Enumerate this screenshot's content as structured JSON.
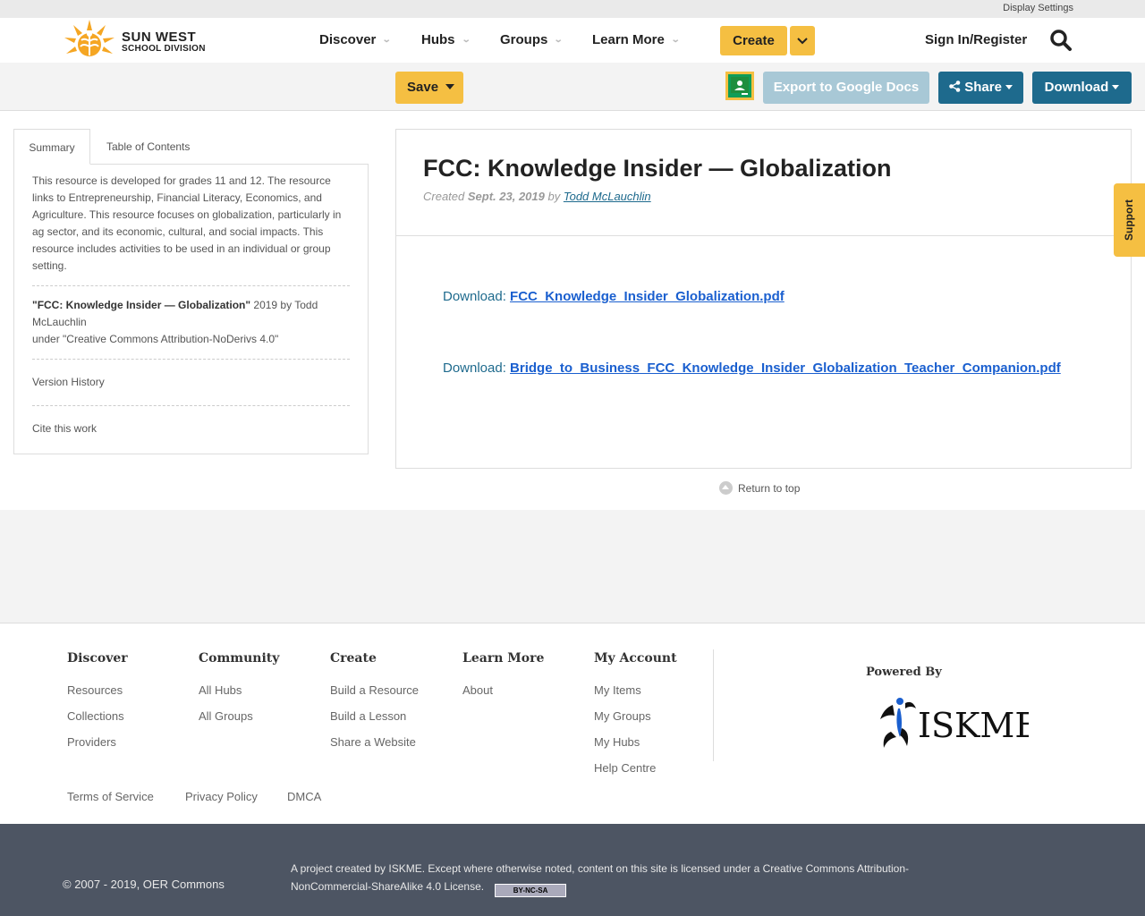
{
  "topbar": {
    "display_settings": "Display Settings"
  },
  "header": {
    "logo": {
      "line1": "SUN WEST",
      "line2": "SCHOOL DIVISION"
    },
    "nav": [
      "Discover",
      "Hubs",
      "Groups",
      "Learn More"
    ],
    "create_label": "Create",
    "signin_label": "Sign In/Register"
  },
  "toolbar": {
    "save_label": "Save",
    "export_label": "Export to Google Docs",
    "share_label": "Share",
    "download_label": "Download"
  },
  "sidebar": {
    "tabs": [
      "Summary",
      "Table of Contents"
    ],
    "summary": "This resource is developed for grades 11 and 12. The resource links to Entrepreneurship, Financial Literacy, Economics, and Agriculture. This resource focuses on globalization, particularly in ag sector, and its economic, cultural, and social impacts. This resource includes activities to be used in an individual or group setting.",
    "attribution_title": "\"FCC: Knowledge Insider — Globalization\"",
    "attribution_rest": " 2019 by Todd McLauchlin",
    "attribution_license": "under \"Creative Commons Attribution-NoDerivs 4.0\"",
    "version_history": "Version History",
    "cite": "Cite this work"
  },
  "resource": {
    "title": "FCC: Knowledge Insider — Globalization",
    "created_prefix": "Created ",
    "created_date": "Sept. 23, 2019",
    "by": " by ",
    "author": "Todd McLauchlin",
    "downloads": [
      {
        "prefix": "Download: ",
        "file": "FCC_Knowledge_Insider_Globalization.pdf"
      },
      {
        "prefix": "Download: ",
        "file": "Bridge_to_Business_FCC_Knowledge_Insider_Globalization_Teacher_Companion.pdf"
      }
    ]
  },
  "return_top": "Return to top",
  "support": "Support",
  "footer": {
    "columns": [
      {
        "heading": "Discover",
        "links": [
          "Resources",
          "Collections",
          "Providers"
        ]
      },
      {
        "heading": "Community",
        "links": [
          "All Hubs",
          "All Groups"
        ]
      },
      {
        "heading": "Create",
        "links": [
          "Build a Resource",
          "Build a Lesson",
          "Share a Website"
        ]
      },
      {
        "heading": "Learn More",
        "links": [
          "About"
        ]
      },
      {
        "heading": "My Account",
        "links": [
          "My Items",
          "My Groups",
          "My Hubs",
          "Help Centre"
        ]
      }
    ],
    "powered_by": "Powered By",
    "iskme": "ISKME",
    "legal": [
      "Terms of Service",
      "Privacy Policy",
      "DMCA"
    ]
  },
  "bottom": {
    "copyright": "© 2007 - 2019, OER Commons",
    "project_text": "A project created by ISKME. Except where otherwise noted, content on this site is licensed under a Creative Commons Attribution-NonCommercial-ShareAlike 4.0 License.",
    "cc_badge": "BY-NC-SA"
  },
  "colors": {
    "accent_yellow": "#f5bf42",
    "primary_blue": "#1e6a8d",
    "link_blue": "#1a5fcf",
    "footer_dark": "#4d5563"
  }
}
